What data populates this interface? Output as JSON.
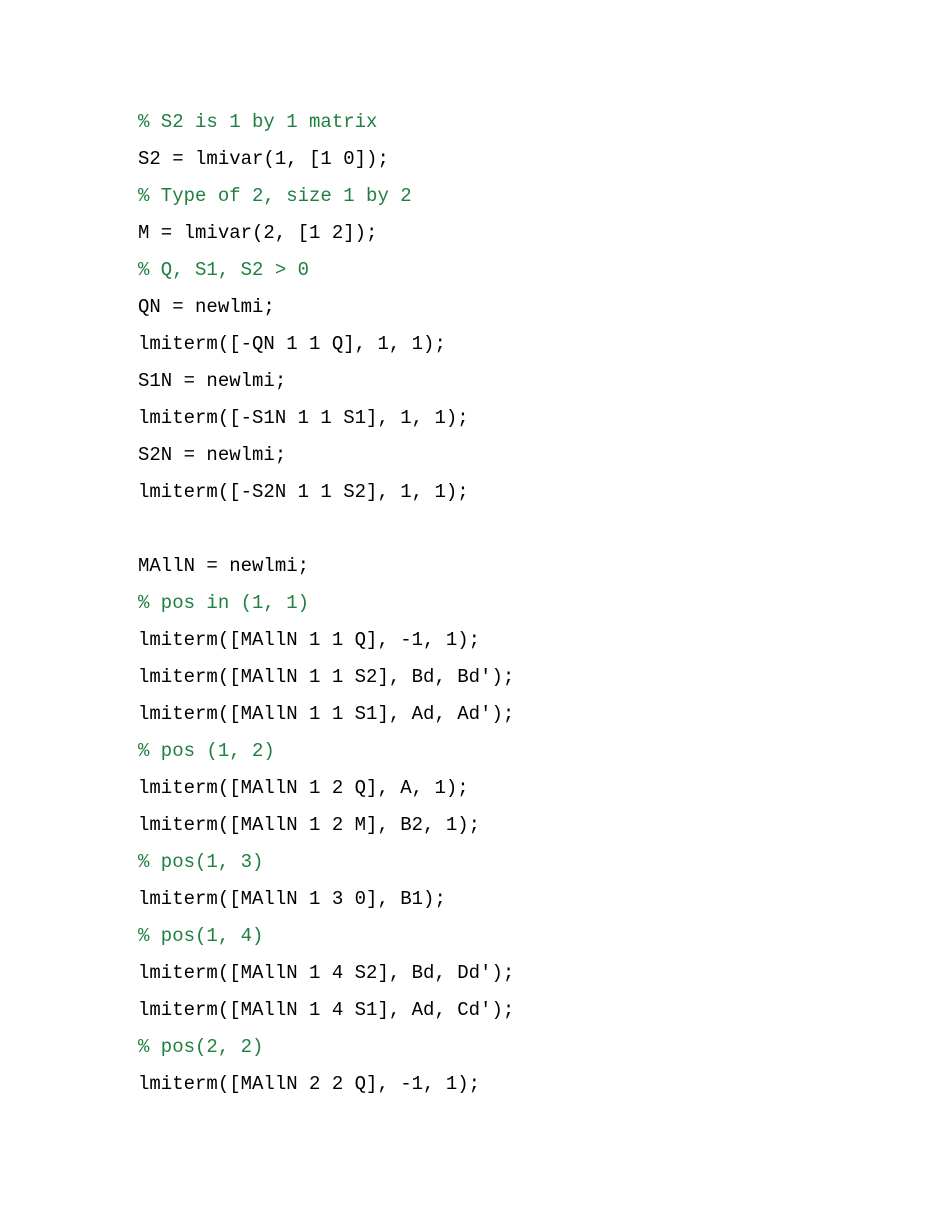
{
  "lines": [
    {
      "type": "comment",
      "text": "% S2 is 1 by 1 matrix"
    },
    {
      "type": "code",
      "text": "S2 = lmivar(1, [1 0]);"
    },
    {
      "type": "comment",
      "text": "% Type of 2, size 1 by 2"
    },
    {
      "type": "code",
      "text": "M = lmivar(2, [1 2]);"
    },
    {
      "type": "comment",
      "text": "% Q, S1, S2 > 0"
    },
    {
      "type": "code",
      "text": "QN = newlmi;"
    },
    {
      "type": "code",
      "text": "lmiterm([-QN 1 1 Q], 1, 1);"
    },
    {
      "type": "code",
      "text": "S1N = newlmi;"
    },
    {
      "type": "code",
      "text": "lmiterm([-S1N 1 1 S1], 1, 1);"
    },
    {
      "type": "code",
      "text": "S2N = newlmi;"
    },
    {
      "type": "code",
      "text": "lmiterm([-S2N 1 1 S2], 1, 1);"
    },
    {
      "type": "blank",
      "text": ""
    },
    {
      "type": "code",
      "text": "MAllN = newlmi;"
    },
    {
      "type": "comment",
      "text": "% pos in (1, 1)"
    },
    {
      "type": "code",
      "text": "lmiterm([MAllN 1 1 Q], -1, 1);"
    },
    {
      "type": "code",
      "text": "lmiterm([MAllN 1 1 S2], Bd, Bd');"
    },
    {
      "type": "code",
      "text": "lmiterm([MAllN 1 1 S1], Ad, Ad');"
    },
    {
      "type": "comment",
      "text": "% pos (1, 2)"
    },
    {
      "type": "code",
      "text": "lmiterm([MAllN 1 2 Q], A, 1);"
    },
    {
      "type": "code",
      "text": "lmiterm([MAllN 1 2 M], B2, 1);"
    },
    {
      "type": "comment",
      "text": "% pos(1, 3)"
    },
    {
      "type": "code",
      "text": "lmiterm([MAllN 1 3 0], B1);"
    },
    {
      "type": "comment",
      "text": "% pos(1, 4)"
    },
    {
      "type": "code",
      "text": "lmiterm([MAllN 1 4 S2], Bd, Dd');"
    },
    {
      "type": "code",
      "text": "lmiterm([MAllN 1 4 S1], Ad, Cd');"
    },
    {
      "type": "comment",
      "text": "% pos(2, 2)"
    },
    {
      "type": "code",
      "text": "lmiterm([MAllN 2 2 Q], -1, 1);"
    }
  ]
}
